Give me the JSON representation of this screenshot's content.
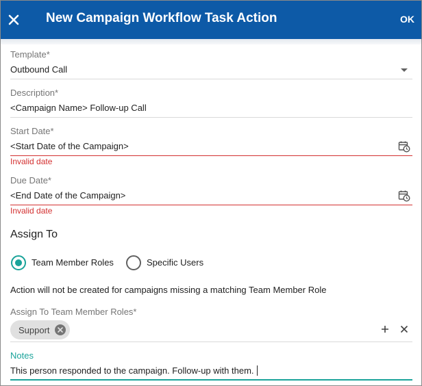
{
  "dialog": {
    "title": "New Campaign Workflow Task Action",
    "ok_label": "OK"
  },
  "template": {
    "label": "Template*",
    "value": "Outbound Call"
  },
  "description": {
    "label": "Description*",
    "value": "<Campaign Name> Follow-up Call"
  },
  "start_date": {
    "label": "Start Date*",
    "value": "<Start Date of the Campaign>",
    "error": "Invalid date"
  },
  "due_date": {
    "label": "Due Date*",
    "value": "<End Date of the Campaign>",
    "error": "Invalid date"
  },
  "assign_to": {
    "heading": "Assign To",
    "options": [
      {
        "label": "Team Member Roles",
        "selected": true
      },
      {
        "label": "Specific Users",
        "selected": false
      }
    ],
    "info": "Action will not be created for campaigns missing a matching Team Member Role",
    "roles_label": "Assign To Team Member Roles*",
    "roles": [
      "Support"
    ]
  },
  "notes": {
    "label": "Notes",
    "value": "This person responded to the campaign. Follow-up with them."
  },
  "colors": {
    "header": "#0d5aa7",
    "accent": "#1aa39a",
    "error": "#d32f2f"
  },
  "icons": [
    "close-icon",
    "dropdown-arrow-icon",
    "calendar-clock-icon",
    "cancel-circle-icon",
    "plus-icon",
    "clear-x-icon"
  ]
}
